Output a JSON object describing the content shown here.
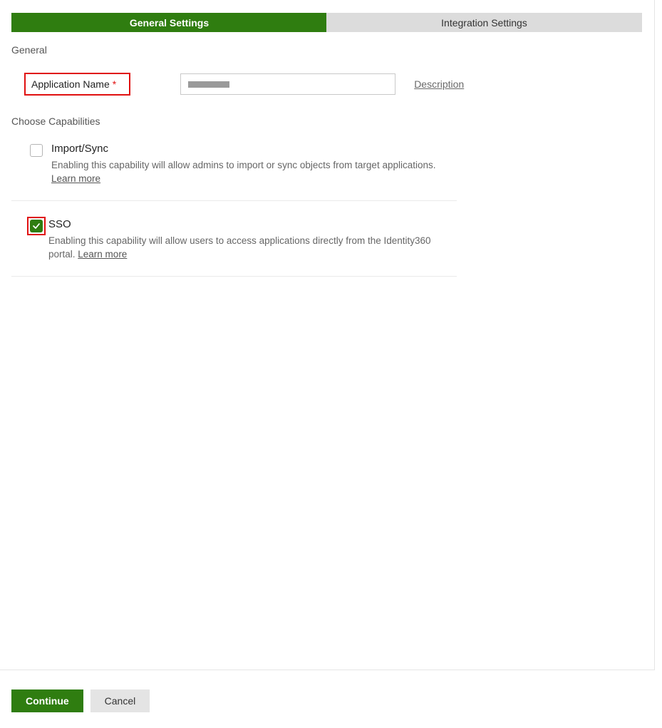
{
  "tabs": {
    "general": "General Settings",
    "integration": "Integration Settings"
  },
  "general": {
    "section_title": "General",
    "app_name_label": "Application Name",
    "required_marker": "*",
    "app_name_value": "",
    "description_link": "Description"
  },
  "capabilities": {
    "section_title": "Choose Capabilities",
    "learn_more_label": "Learn more",
    "items": [
      {
        "title": "Import/Sync",
        "checked": false,
        "description": "Enabling this capability will allow admins to import or sync objects from target applications. "
      },
      {
        "title": "SSO",
        "checked": true,
        "description": "Enabling this capability will allow users to access applications directly from the Identity360 portal. "
      }
    ]
  },
  "footer": {
    "continue": "Continue",
    "cancel": "Cancel"
  }
}
